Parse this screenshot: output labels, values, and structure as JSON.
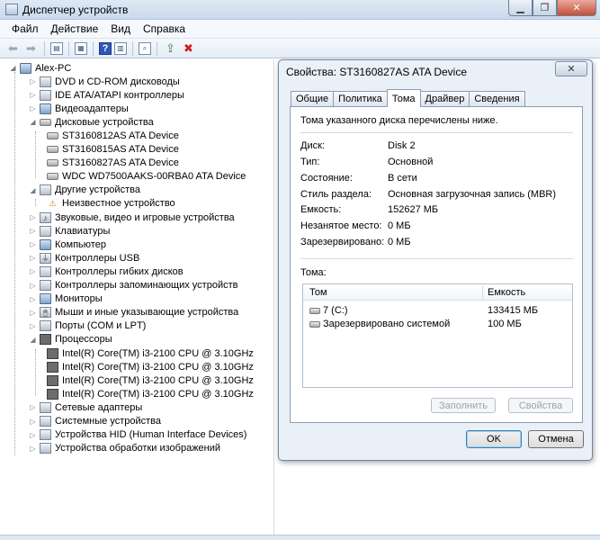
{
  "window": {
    "title": "Диспетчер устройств"
  },
  "menu": [
    "Файл",
    "Действие",
    "Вид",
    "Справка"
  ],
  "tree": {
    "root": "Alex-PC",
    "items": [
      {
        "label": "DVD и CD-ROM дисководы",
        "icon": "dvd-drive-icon",
        "level": 1,
        "state": "collapsed"
      },
      {
        "label": "IDE ATA/ATAPI контроллеры",
        "icon": "ide-controller-icon",
        "level": 1,
        "state": "collapsed"
      },
      {
        "label": "Видеоадаптеры",
        "icon": "display-adapter-icon",
        "level": 1,
        "state": "collapsed"
      },
      {
        "label": "Дисковые устройства",
        "icon": "disk-drive-icon",
        "level": 1,
        "state": "expanded"
      },
      {
        "label": "ST3160812AS ATA Device",
        "icon": "disk-icon",
        "level": 2,
        "state": "leaf"
      },
      {
        "label": "ST3160815AS ATA Device",
        "icon": "disk-icon",
        "level": 2,
        "state": "leaf"
      },
      {
        "label": "ST3160827AS ATA Device",
        "icon": "disk-icon",
        "level": 2,
        "state": "leaf"
      },
      {
        "label": "WDC WD7500AAKS-00RBA0 ATA Device",
        "icon": "disk-icon",
        "level": 2,
        "state": "leaf"
      },
      {
        "label": "Другие устройства",
        "icon": "other-devices-icon",
        "level": 1,
        "state": "expanded"
      },
      {
        "label": "Неизвестное устройство",
        "icon": "warning-icon",
        "level": 2,
        "state": "leaf"
      },
      {
        "label": "Звуковые, видео и игровые устройства",
        "icon": "sound-icon",
        "level": 1,
        "state": "collapsed"
      },
      {
        "label": "Клавиатуры",
        "icon": "keyboard-icon",
        "level": 1,
        "state": "collapsed"
      },
      {
        "label": "Компьютер",
        "icon": "computer-icon",
        "level": 1,
        "state": "collapsed"
      },
      {
        "label": "Контроллеры USB",
        "icon": "usb-icon",
        "level": 1,
        "state": "collapsed"
      },
      {
        "label": "Контроллеры гибких дисков",
        "icon": "floppy-controller-icon",
        "level": 1,
        "state": "collapsed"
      },
      {
        "label": "Контроллеры запоминающих устройств",
        "icon": "storage-controller-icon",
        "level": 1,
        "state": "collapsed"
      },
      {
        "label": "Мониторы",
        "icon": "monitor-icon",
        "level": 1,
        "state": "collapsed"
      },
      {
        "label": "Мыши и иные указывающие устройства",
        "icon": "mouse-icon",
        "level": 1,
        "state": "collapsed"
      },
      {
        "label": "Порты (COM и LPT)",
        "icon": "port-icon",
        "level": 1,
        "state": "collapsed"
      },
      {
        "label": "Процессоры",
        "icon": "processor-icon",
        "level": 1,
        "state": "expanded"
      },
      {
        "label": "Intel(R) Core(TM) i3-2100 CPU @ 3.10GHz",
        "icon": "cpu-chip-icon",
        "level": 2,
        "state": "leaf"
      },
      {
        "label": "Intel(R) Core(TM) i3-2100 CPU @ 3.10GHz",
        "icon": "cpu-chip-icon",
        "level": 2,
        "state": "leaf"
      },
      {
        "label": "Intel(R) Core(TM) i3-2100 CPU @ 3.10GHz",
        "icon": "cpu-chip-icon",
        "level": 2,
        "state": "leaf"
      },
      {
        "label": "Intel(R) Core(TM) i3-2100 CPU @ 3.10GHz",
        "icon": "cpu-chip-icon",
        "level": 2,
        "state": "leaf"
      },
      {
        "label": "Сетевые адаптеры",
        "icon": "network-adapter-icon",
        "level": 1,
        "state": "collapsed"
      },
      {
        "label": "Системные устройства",
        "icon": "system-devices-icon",
        "level": 1,
        "state": "collapsed"
      },
      {
        "label": "Устройства HID (Human Interface Devices)",
        "icon": "hid-icon",
        "level": 1,
        "state": "collapsed"
      },
      {
        "label": "Устройства обработки изображений",
        "icon": "imaging-icon",
        "level": 1,
        "state": "collapsed"
      }
    ]
  },
  "dialog": {
    "title": "Свойства: ST3160827AS ATA Device",
    "close_label": "✕",
    "tabs": [
      "Общие",
      "Политика",
      "Тома",
      "Драйвер",
      "Сведения"
    ],
    "active_tab": 2,
    "description": "Тома указанного диска перечислены ниже.",
    "properties": [
      {
        "label": "Диск:",
        "value": "Disk 2"
      },
      {
        "label": "Тип:",
        "value": "Основной"
      },
      {
        "label": "Состояние:",
        "value": "В сети"
      },
      {
        "label": "Стиль раздела:",
        "value": "Основная загрузочная запись (MBR)"
      },
      {
        "label": "Емкость:",
        "value": "152627 МБ"
      },
      {
        "label": "Незанятое место:",
        "value": "0 МБ"
      },
      {
        "label": "Зарезервировано:",
        "value": "0 МБ"
      }
    ],
    "volumes_caption": "Тома:",
    "volumes_headers": [
      "Том",
      "Емкость"
    ],
    "volumes": [
      {
        "name": "7 (C:)",
        "capacity": "133415 МБ"
      },
      {
        "name": "Зарезервировано системой",
        "capacity": "100 МБ"
      }
    ],
    "populate_label": "Заполнить",
    "properties_label": "Свойства",
    "ok_label": "OK",
    "cancel_label": "Отмена"
  },
  "colors": {
    "accent": "#3c7fb1",
    "window_frame": "#c9d9ec"
  }
}
